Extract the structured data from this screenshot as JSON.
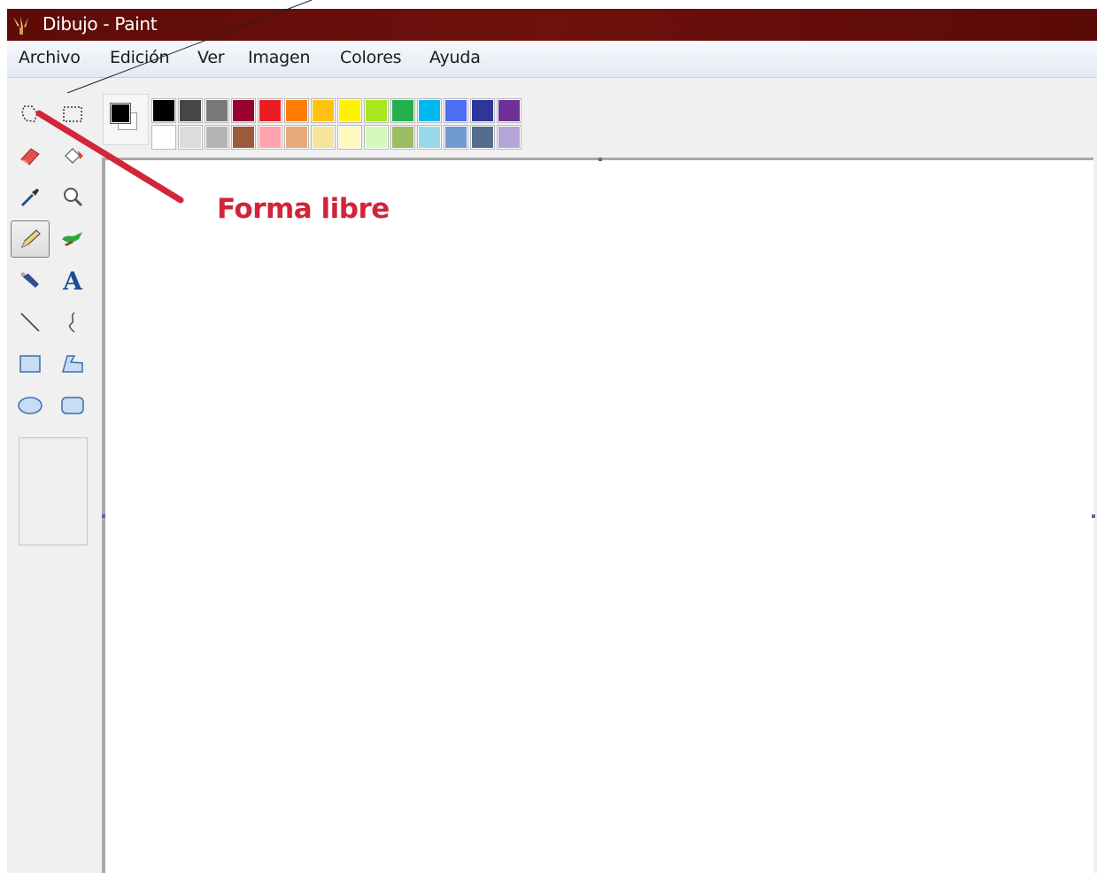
{
  "window": {
    "title": "Dibujo - Paint"
  },
  "menu": {
    "items": [
      {
        "label": "Archivo"
      },
      {
        "label": "Edición"
      },
      {
        "label": "Ver"
      },
      {
        "label": "Imagen"
      },
      {
        "label": "Colores"
      },
      {
        "label": "Ayuda"
      }
    ]
  },
  "toolbox": {
    "tools": [
      {
        "icon": "free-form-select-icon"
      },
      {
        "icon": "rectangle-select-icon"
      },
      {
        "icon": "eraser-icon"
      },
      {
        "icon": "fill-bucket-icon"
      },
      {
        "icon": "color-picker-icon"
      },
      {
        "icon": "magnifier-icon"
      },
      {
        "icon": "pencil-icon",
        "active": true
      },
      {
        "icon": "brush-icon"
      },
      {
        "icon": "airbrush-icon"
      },
      {
        "icon": "text-icon",
        "glyph": "A"
      },
      {
        "icon": "line-icon"
      },
      {
        "icon": "curve-icon"
      },
      {
        "icon": "rectangle-icon"
      },
      {
        "icon": "polygon-icon"
      },
      {
        "icon": "ellipse-icon"
      },
      {
        "icon": "rounded-rectangle-icon"
      }
    ]
  },
  "colors": {
    "foreground": "#000000",
    "background": "#ffffff",
    "palette_top": [
      "#000000",
      "#464646",
      "#787878",
      "#990030",
      "#ed1c24",
      "#ff7e00",
      "#ffc20e",
      "#fff200",
      "#a8e61d",
      "#22b14c",
      "#00b7ef",
      "#4d6df3",
      "#2f3699",
      "#6f3198"
    ],
    "palette_bottom": [
      "#ffffff",
      "#dcdcdc",
      "#b4b4b4",
      "#9c5a3c",
      "#ffa3b1",
      "#e5aa7a",
      "#f5e49c",
      "#fff9bd",
      "#d3f9bc",
      "#9dbb61",
      "#99d9ea",
      "#709ad1",
      "#546d8e",
      "#b5a5d5"
    ]
  },
  "annotation": {
    "label": "Forma libre",
    "color": "#d2243a"
  }
}
